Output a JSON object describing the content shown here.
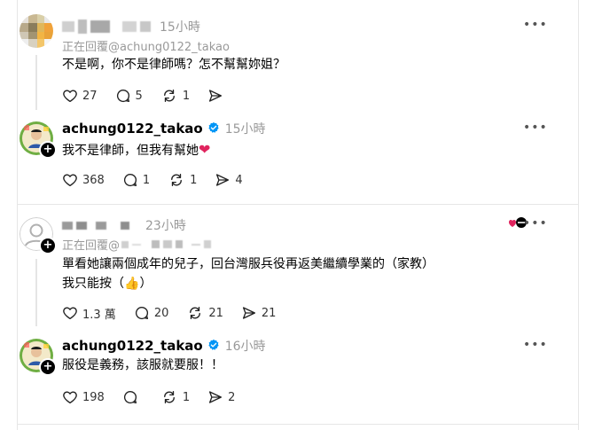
{
  "posts": [
    {
      "username": "",
      "time": "15小時",
      "replying_to": "正在回覆@achung0122_takao",
      "text": "不是啊，你不是律師嗎？怎不幫幫妳姐？",
      "likes": "27",
      "comments": "5",
      "reposts": "1",
      "shares": ""
    },
    {
      "username": "achung0122_takao",
      "time": "15小時",
      "text_before_emoji": "我不是律師，但我有幫她",
      "emoji": "❤",
      "likes": "368",
      "comments": "1",
      "reposts": "1",
      "shares": "4"
    },
    {
      "username": "",
      "time": "23小時",
      "replying_to": "正在回覆@",
      "text_line1": "單看她讓兩個成年的兒子，回台灣服兵役再返美繼續學業的（家教）",
      "text_line2_before": "我只能按（",
      "text_line2_emoji": "👍",
      "text_line2_after": "）",
      "likes": "1.3 萬",
      "comments": "20",
      "reposts": "21",
      "shares": "21"
    },
    {
      "username": "achung0122_takao",
      "time": "16小時",
      "text": "服役是義務，該服就要服！！",
      "likes": "198",
      "comments": "",
      "reposts": "1",
      "shares": "2"
    }
  ],
  "more_label": "•••",
  "icons": {
    "like": "heart-icon",
    "comment": "comment-icon",
    "repost": "repost-icon",
    "share": "share-icon",
    "verified": "verified-badge-icon",
    "more": "more-options-icon"
  },
  "colors": {
    "verified": "#0095f6",
    "heart_emoji": "#e0245e",
    "muted_text": "#999999"
  }
}
